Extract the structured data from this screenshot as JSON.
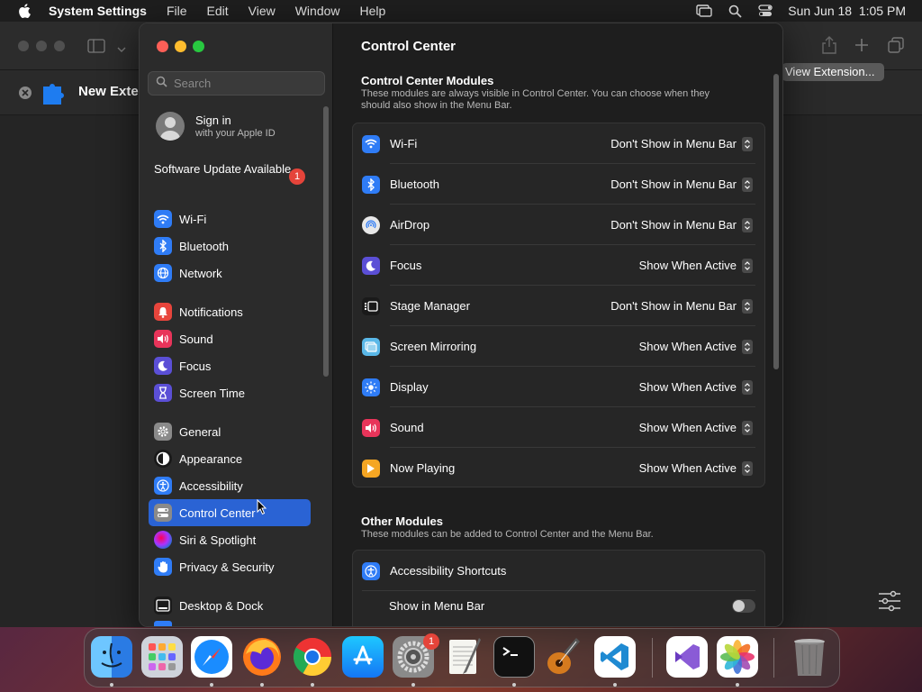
{
  "menubar": {
    "app": "System Settings",
    "items": [
      "File",
      "Edit",
      "View",
      "Window",
      "Help"
    ],
    "datetime": "Sun Jun 18  1:05 PM"
  },
  "background_window": {
    "title": "New Exten",
    "button": "View Extension..."
  },
  "settings": {
    "search_placeholder": "Search",
    "signin_title": "Sign in",
    "signin_sub": "with your Apple ID",
    "software_update": "Software Update Available",
    "software_update_badge": "1",
    "sidebar": [
      {
        "label": "Wi-Fi",
        "icon": "wifi-icon",
        "color": "#2f7cf6",
        "top": 0
      },
      {
        "label": "Bluetooth",
        "icon": "bluetooth-icon",
        "color": "#2f7cf6"
      },
      {
        "label": "Network",
        "icon": "globe-icon",
        "color": "#2f7cf6"
      },
      {
        "label": "Notifications",
        "icon": "bell-icon",
        "color": "#e8453c"
      },
      {
        "label": "Sound",
        "icon": "speaker-icon",
        "color": "#e8345a"
      },
      {
        "label": "Focus",
        "icon": "moon-icon",
        "color": "#5b4fd6"
      },
      {
        "label": "Screen Time",
        "icon": "hourglass-icon",
        "color": "#5b4fd6"
      },
      {
        "label": "General",
        "icon": "gear-icon",
        "color": "#8a8a8a"
      },
      {
        "label": "Appearance",
        "icon": "appearance-icon",
        "color": "#1a1a1a"
      },
      {
        "label": "Accessibility",
        "icon": "accessibility-icon",
        "color": "#2f7cf6"
      },
      {
        "label": "Control Center",
        "icon": "control-center-icon",
        "color": "#8a8a8a"
      },
      {
        "label": "Siri & Spotlight",
        "icon": "siri-icon",
        "color": "#7a3fd0"
      },
      {
        "label": "Privacy & Security",
        "icon": "hand-icon",
        "color": "#2f7cf6"
      },
      {
        "label": "Desktop & Dock",
        "icon": "dock-icon",
        "color": "#1a1a1a"
      }
    ],
    "main_title": "Control Center",
    "modules_title": "Control Center Modules",
    "modules_desc": "These modules are always visible in Control Center. You can choose when they should also show in the Menu Bar.",
    "modules": [
      {
        "label": "Wi-Fi",
        "value": "Don't Show in Menu Bar",
        "icon": "wifi-icon",
        "color": "#2f7cf6"
      },
      {
        "label": "Bluetooth",
        "value": "Don't Show in Menu Bar",
        "icon": "bluetooth-icon",
        "color": "#2f7cf6"
      },
      {
        "label": "AirDrop",
        "value": "Don't Show in Menu Bar",
        "icon": "airdrop-icon",
        "color": "#e8e8e8"
      },
      {
        "label": "Focus",
        "value": "Show When Active",
        "icon": "moon-icon",
        "color": "#5b4fd6"
      },
      {
        "label": "Stage Manager",
        "value": "Don't Show in Menu Bar",
        "icon": "stage-manager-icon",
        "color": "#1a1a1a"
      },
      {
        "label": "Screen Mirroring",
        "value": "Show When Active",
        "icon": "screen-mirroring-icon",
        "color": "#5ab8e8"
      },
      {
        "label": "Display",
        "value": "Show When Active",
        "icon": "sun-icon",
        "color": "#2f7cf6"
      },
      {
        "label": "Sound",
        "value": "Show When Active",
        "icon": "speaker-icon",
        "color": "#e8345a"
      },
      {
        "label": "Now Playing",
        "value": "Show When Active",
        "icon": "play-icon",
        "color": "#f5a623"
      }
    ],
    "other_title": "Other Modules",
    "other_desc": "These modules can be added to Control Center and the Menu Bar.",
    "accessibility_shortcuts": "Accessibility Shortcuts",
    "show_in_menu_bar": "Show in Menu Bar"
  },
  "dock": {
    "settings_badge": "1",
    "apps": [
      "Finder",
      "Launchpad",
      "Safari",
      "Firefox",
      "Chrome",
      "App Store",
      "System Settings",
      "TextEdit",
      "Terminal",
      "GarageBand",
      "Visual Studio Code",
      "Visual Studio",
      "Photos",
      "Trash"
    ]
  }
}
